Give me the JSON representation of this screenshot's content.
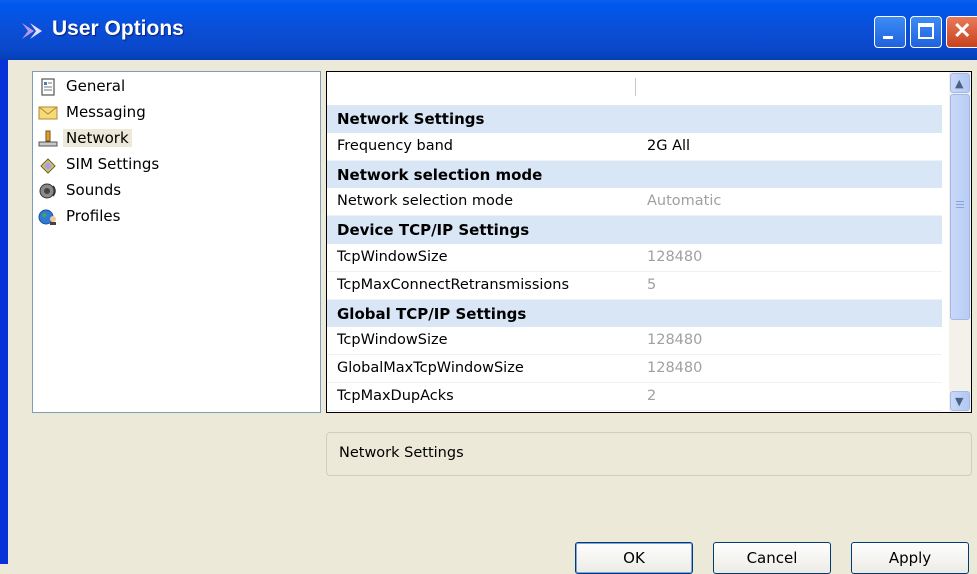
{
  "window": {
    "title": "User Options",
    "buttons": {
      "minimize": "minimize",
      "maximize": "maximize",
      "close": "close"
    }
  },
  "tree": {
    "items": [
      {
        "label": "General",
        "icon": "document-icon"
      },
      {
        "label": "Messaging",
        "icon": "envelope-icon"
      },
      {
        "label": "Network",
        "icon": "network-icon",
        "selected": true
      },
      {
        "label": "SIM Settings",
        "icon": "sim-card-icon"
      },
      {
        "label": "Sounds",
        "icon": "speaker-icon"
      },
      {
        "label": "Profiles",
        "icon": "globe-person-icon"
      }
    ]
  },
  "grid": {
    "rows": [
      {
        "type": "category",
        "name": "Network Settings"
      },
      {
        "type": "property",
        "name": "Frequency band",
        "value": "2G All",
        "editable": true
      },
      {
        "type": "category",
        "name": "Network selection mode"
      },
      {
        "type": "property",
        "name": "Network selection mode",
        "value": "Automatic",
        "editable": false
      },
      {
        "type": "category",
        "name": "Device TCP/IP Settings"
      },
      {
        "type": "property",
        "name": "TcpWindowSize",
        "value": "128480",
        "editable": false
      },
      {
        "type": "property",
        "name": "TcpMaxConnectRetransmissions",
        "value": "5",
        "editable": false
      },
      {
        "type": "category",
        "name": "Global TCP/IP Settings"
      },
      {
        "type": "property",
        "name": "TcpWindowSize",
        "value": "128480",
        "editable": false
      },
      {
        "type": "property",
        "name": "GlobalMaxTcpWindowSize",
        "value": "128480",
        "editable": false
      },
      {
        "type": "property",
        "name": "TcpMaxDupAcks",
        "value": "2",
        "editable": false
      }
    ]
  },
  "description": "Network Settings",
  "footer": {
    "ok_label": "OK",
    "cancel_label": "Cancel",
    "apply_label": "Apply"
  },
  "colors": {
    "titlebar": "#0a4fd8",
    "category_row": "#d9e6f6",
    "readonly_text": "#a0a0a0",
    "dialog_bg": "#ece9d8"
  }
}
